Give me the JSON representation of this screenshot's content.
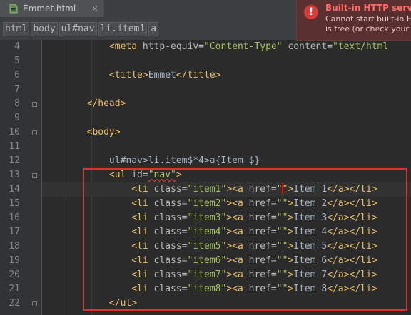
{
  "tab": {
    "filename": "Emmet.html",
    "close_glyph": "×"
  },
  "breadcrumb": [
    "html",
    "body",
    "ul#nav",
    "li.item1",
    "a"
  ],
  "notification": {
    "title": "Built-in HTTP server",
    "line1": "Cannot start built-in H",
    "line2": "is free (or check your",
    "icon": "!"
  },
  "editor": {
    "lines": [
      {
        "num": "4",
        "fold": false
      },
      {
        "num": "5",
        "fold": false
      },
      {
        "num": "6",
        "fold": false
      },
      {
        "num": "7",
        "fold": false
      },
      {
        "num": "8",
        "fold": true
      },
      {
        "num": "9",
        "fold": false
      },
      {
        "num": "10",
        "fold": true
      },
      {
        "num": "11",
        "fold": false
      },
      {
        "num": "12",
        "fold": false
      },
      {
        "num": "13",
        "fold": true
      },
      {
        "num": "14",
        "fold": false
      },
      {
        "num": "15",
        "fold": false
      },
      {
        "num": "16",
        "fold": false
      },
      {
        "num": "17",
        "fold": false
      },
      {
        "num": "18",
        "fold": false
      },
      {
        "num": "19",
        "fold": false
      },
      {
        "num": "20",
        "fold": false
      },
      {
        "num": "21",
        "fold": false
      },
      {
        "num": "22",
        "fold": true
      }
    ],
    "code": {
      "l4_open": "<meta ",
      "l4_attr1": "http-equiv=",
      "l4_val1": "\"Content-Type\"",
      "l4_attr2": " content=",
      "l4_val2": "\"text/html",
      "l6_open": "<title>",
      "l6_text": "Emmet",
      "l6_close": "</title>",
      "l8": "</head>",
      "l10": "<body>",
      "l12": "ul#nav>li.item$*4>a{Item $}",
      "l13_open": "<ul ",
      "l13_attr": "id=",
      "l13_val": "\"nav\"",
      "l13_end": ">",
      "l22": "</ul>",
      "items": [
        {
          "cls": "\"item1\"",
          "text": "Item 1"
        },
        {
          "cls": "\"item2\"",
          "text": "Item 2"
        },
        {
          "cls": "\"item3\"",
          "text": "Item 3"
        },
        {
          "cls": "\"item4\"",
          "text": "Item 4"
        },
        {
          "cls": "\"item5\"",
          "text": "Item 5"
        },
        {
          "cls": "\"item6\"",
          "text": "Item 6"
        },
        {
          "cls": "\"item7\"",
          "text": "Item 7"
        },
        {
          "cls": "\"item8\"",
          "text": "Item 8"
        }
      ],
      "li_open": "<li ",
      "class_attr": "class=",
      "a_open": "><a ",
      "href_attr": "href=",
      "quote_open": "\"",
      "quote_close": "\"",
      "empty_href": "\"\"",
      "gt": ">",
      "a_close": "</a>",
      "li_close": "</li>"
    }
  },
  "colors": {
    "background": "#2b2b2b",
    "tag": "#e8bf6a",
    "attribute": "#bababa",
    "string": "#a5c261",
    "highlight_box": "#e03030",
    "error": "#d43b3b"
  }
}
